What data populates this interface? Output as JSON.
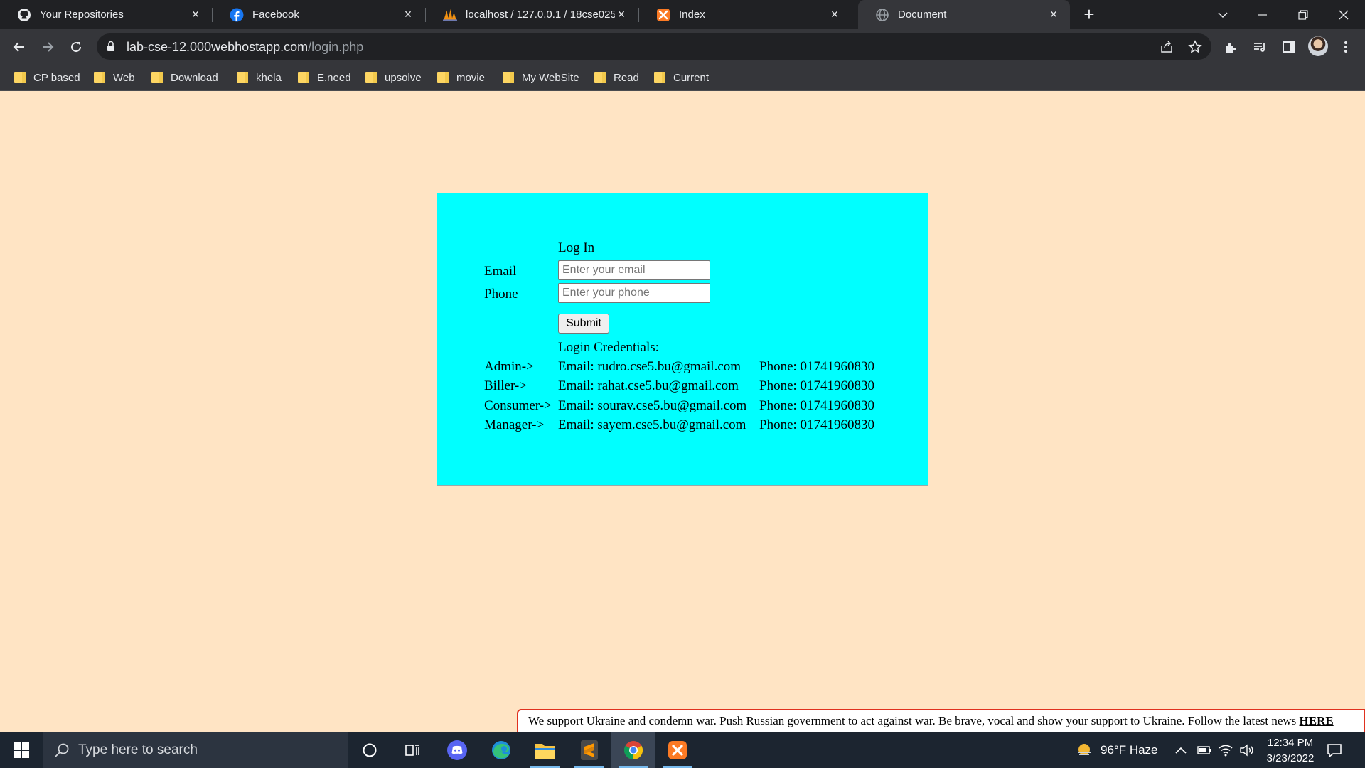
{
  "browser": {
    "tabs": [
      {
        "title": "Your Repositories",
        "icon": "github-icon"
      },
      {
        "title": "Facebook",
        "icon": "facebook-icon"
      },
      {
        "title": "localhost / 127.0.0.1 / 18cse025 |",
        "icon": "phpmyadmin-icon"
      },
      {
        "title": "Index",
        "icon": "xampp-icon"
      },
      {
        "title": "Document",
        "icon": "globe-icon",
        "active": true
      }
    ],
    "url_host": "lab-cse-12.000webhostapp.com",
    "url_path": "/login.php",
    "bookmarks": [
      "CP based",
      "Web",
      "Download",
      "khela",
      "E.need",
      "upsolve",
      "movie",
      "My WebSite",
      "Read",
      "Current"
    ]
  },
  "login": {
    "heading": "Log In",
    "email_label": "Email",
    "phone_label": "Phone",
    "email_placeholder": "Enter your email",
    "phone_placeholder": "Enter your phone",
    "submit_label": "Submit",
    "credentials_heading": "Login Credentials:",
    "credentials": [
      {
        "role": "Admin->",
        "email": "Email: rudro.cse5.bu@gmail.com",
        "phone": "Phone: 01741960830"
      },
      {
        "role": "Biller->",
        "email": "Email: rahat.cse5.bu@gmail.com",
        "phone": "Phone: 01741960830"
      },
      {
        "role": "Consumer->",
        "email": "Email: sourav.cse5.bu@gmail.com",
        "phone": "Phone: 01741960830"
      },
      {
        "role": "Manager->",
        "email": "Email: sayem.cse5.bu@gmail.com",
        "phone": "Phone: 01741960830"
      }
    ]
  },
  "banner": {
    "text": "We support Ukraine and condemn war. Push Russian government to act against war. Be brave, vocal and show your support to Ukraine. Follow the latest news ",
    "link": "HERE",
    "border_color": "#e0311f"
  },
  "taskbar": {
    "search_placeholder": "Type here to search",
    "weather": "96°F  Haze",
    "time": "12:34 PM",
    "date": "3/23/2022"
  },
  "colors": {
    "page_background": "#ffe4c4",
    "login_box": "#00ffff",
    "browser_frame": "#202124"
  }
}
